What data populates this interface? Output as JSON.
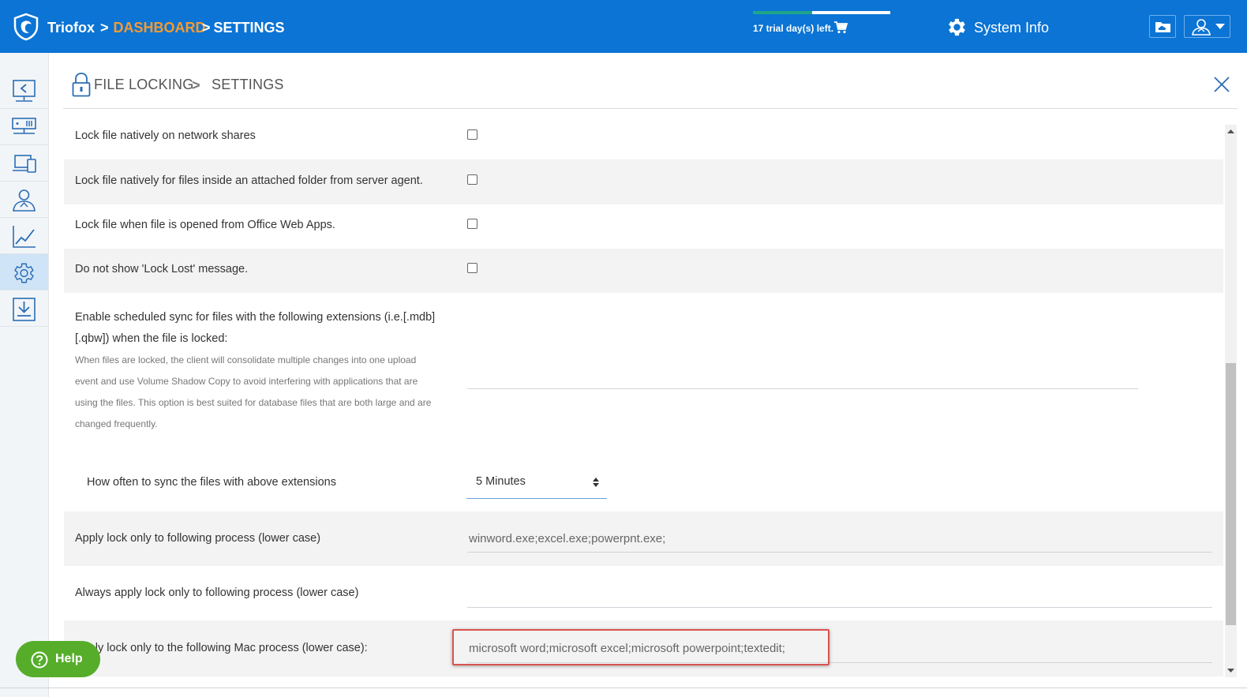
{
  "topbar": {
    "brand": "Triofox",
    "crumb_sep1": ">",
    "crumb_dashboard": "DASHBOARD",
    "crumb_sep2": ">",
    "crumb_settings": "SETTINGS",
    "trial_text": "17 trial day(s) left.",
    "trial_progress": 0.43,
    "system_info": "System Info",
    "colors": {
      "bar": "#0b74d4",
      "dashboard": "#f59a33",
      "trial_fill": "#1fa589"
    }
  },
  "sidebar": {
    "items": [
      {
        "icon": "share-screen-icon",
        "active": false
      },
      {
        "icon": "server-network-icon",
        "active": false
      },
      {
        "icon": "devices-icon",
        "active": false
      },
      {
        "icon": "users-icon",
        "active": false
      },
      {
        "icon": "chart-icon",
        "active": false
      },
      {
        "icon": "settings-gear-icon",
        "active": true
      },
      {
        "icon": "download-icon",
        "active": false
      }
    ]
  },
  "header": {
    "section": "FILE LOCKING",
    "separator": ">",
    "page": "SETTINGS"
  },
  "settings": {
    "lock_native_shares": {
      "label": "Lock file natively on network shares",
      "checked": false
    },
    "lock_native_attached": {
      "label": "Lock file natively for files inside an attached folder from server agent.",
      "checked": false
    },
    "lock_office_web": {
      "label": "Lock file when file is opened from Office Web Apps.",
      "checked": false
    },
    "no_lock_lost": {
      "label": "Do not show 'Lock Lost' message.",
      "checked": false
    },
    "scheduled_sync": {
      "label_line1": "Enable scheduled sync for files with the following extensions (i.e.[.mdb]",
      "label_line2": "[.qbw]) when the file is locked:",
      "note_lines": [
        "When files are locked, the client will consolidate multiple changes into one upload",
        "event and use Volume Shadow Copy to avoid interfering with applications that are",
        "using the files. This option is best suited for database files that are both large and are",
        "changed frequently."
      ],
      "value": ""
    },
    "sync_interval": {
      "label": "How often to sync the files with above extensions",
      "value": "5 Minutes"
    },
    "apply_lock_process": {
      "label": "Apply lock only to following process (lower case)",
      "value": "winword.exe;excel.exe;powerpnt.exe;"
    },
    "always_apply_lock_process": {
      "label": "Always apply lock only to following process (lower case)",
      "value": ""
    },
    "mac_process": {
      "label": "Apply lock only to the following Mac process (lower case):",
      "value": "microsoft word;microsoft excel;microsoft powerpoint;textedit;"
    }
  },
  "help": {
    "label": "Help"
  }
}
